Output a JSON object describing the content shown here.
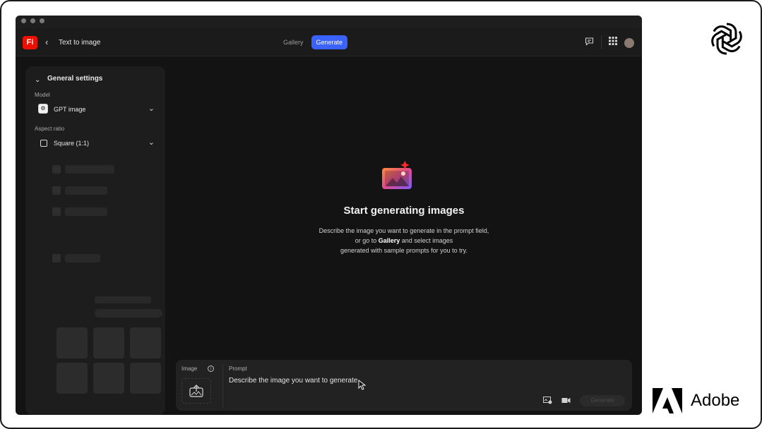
{
  "app": {
    "logo_text": "Fi",
    "page_title": "Text to image",
    "back_icon": "chevron-left-icon"
  },
  "nav": {
    "tabs": [
      {
        "label": "Gallery",
        "active": false
      },
      {
        "label": "Generate",
        "active": true
      }
    ],
    "accent_color": "#3b63fb"
  },
  "toolbar_icons": [
    "chat-icon",
    "apps-grid-icon",
    "avatar"
  ],
  "sidebar": {
    "section_title": "General settings",
    "model": {
      "label": "Model",
      "value": "GPT image",
      "icon": "openai-icon"
    },
    "aspect_ratio": {
      "label": "Aspect ratio",
      "value": "Square (1:1)",
      "icon": "square-icon"
    }
  },
  "empty_state": {
    "title": "Start generating images",
    "line1": "Describe the image you want to generate in the prompt field,",
    "line2_pre": "or go to ",
    "line2_bold": "Gallery",
    "line2_post": " and select images",
    "line3": "generated with sample prompts for you to try."
  },
  "prompt_panel": {
    "image_label": "Image",
    "prompt_label": "Prompt",
    "prompt_placeholder": "Describe the image you want to generate",
    "generate_label": "Generate"
  },
  "branding": {
    "adobe_word": "Adobe",
    "brand_red": "#eb1000"
  }
}
